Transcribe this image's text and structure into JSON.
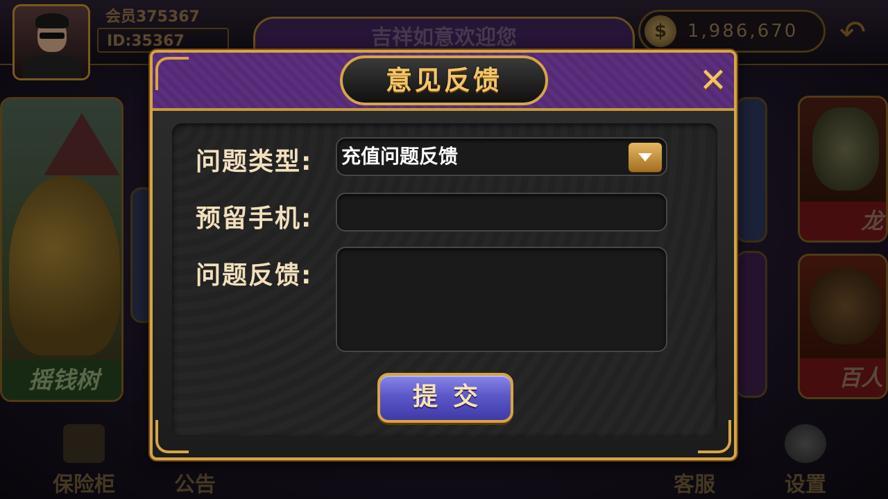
{
  "header": {
    "nickname": "会员375367",
    "user_id": "ID:35367",
    "welcome_text": "吉祥如意欢迎您",
    "coin_icon": "$",
    "coin_balance": "1,986,670"
  },
  "lobby": {
    "games": [
      {
        "label": "摇钱树"
      },
      {
        "label": "龙"
      },
      {
        "label": "百人"
      }
    ],
    "bottom_nav": {
      "safe": "保险柜",
      "notice": "公告",
      "service": "客服",
      "settings": "设置"
    }
  },
  "dialog": {
    "title": "意见反馈",
    "close_icon": "✕",
    "form": {
      "type_label": "问题类型:",
      "type_selected": "充值问题反馈",
      "phone_label": "预留手机:",
      "phone_value": "",
      "feedback_label": "问题反馈:",
      "feedback_value": ""
    },
    "submit_label": "提交"
  },
  "colors": {
    "gold": "#d6a544",
    "header_purple": "#5c2f7e",
    "button_purple": "#5c58c8",
    "label_text": "#f2dfbd"
  }
}
